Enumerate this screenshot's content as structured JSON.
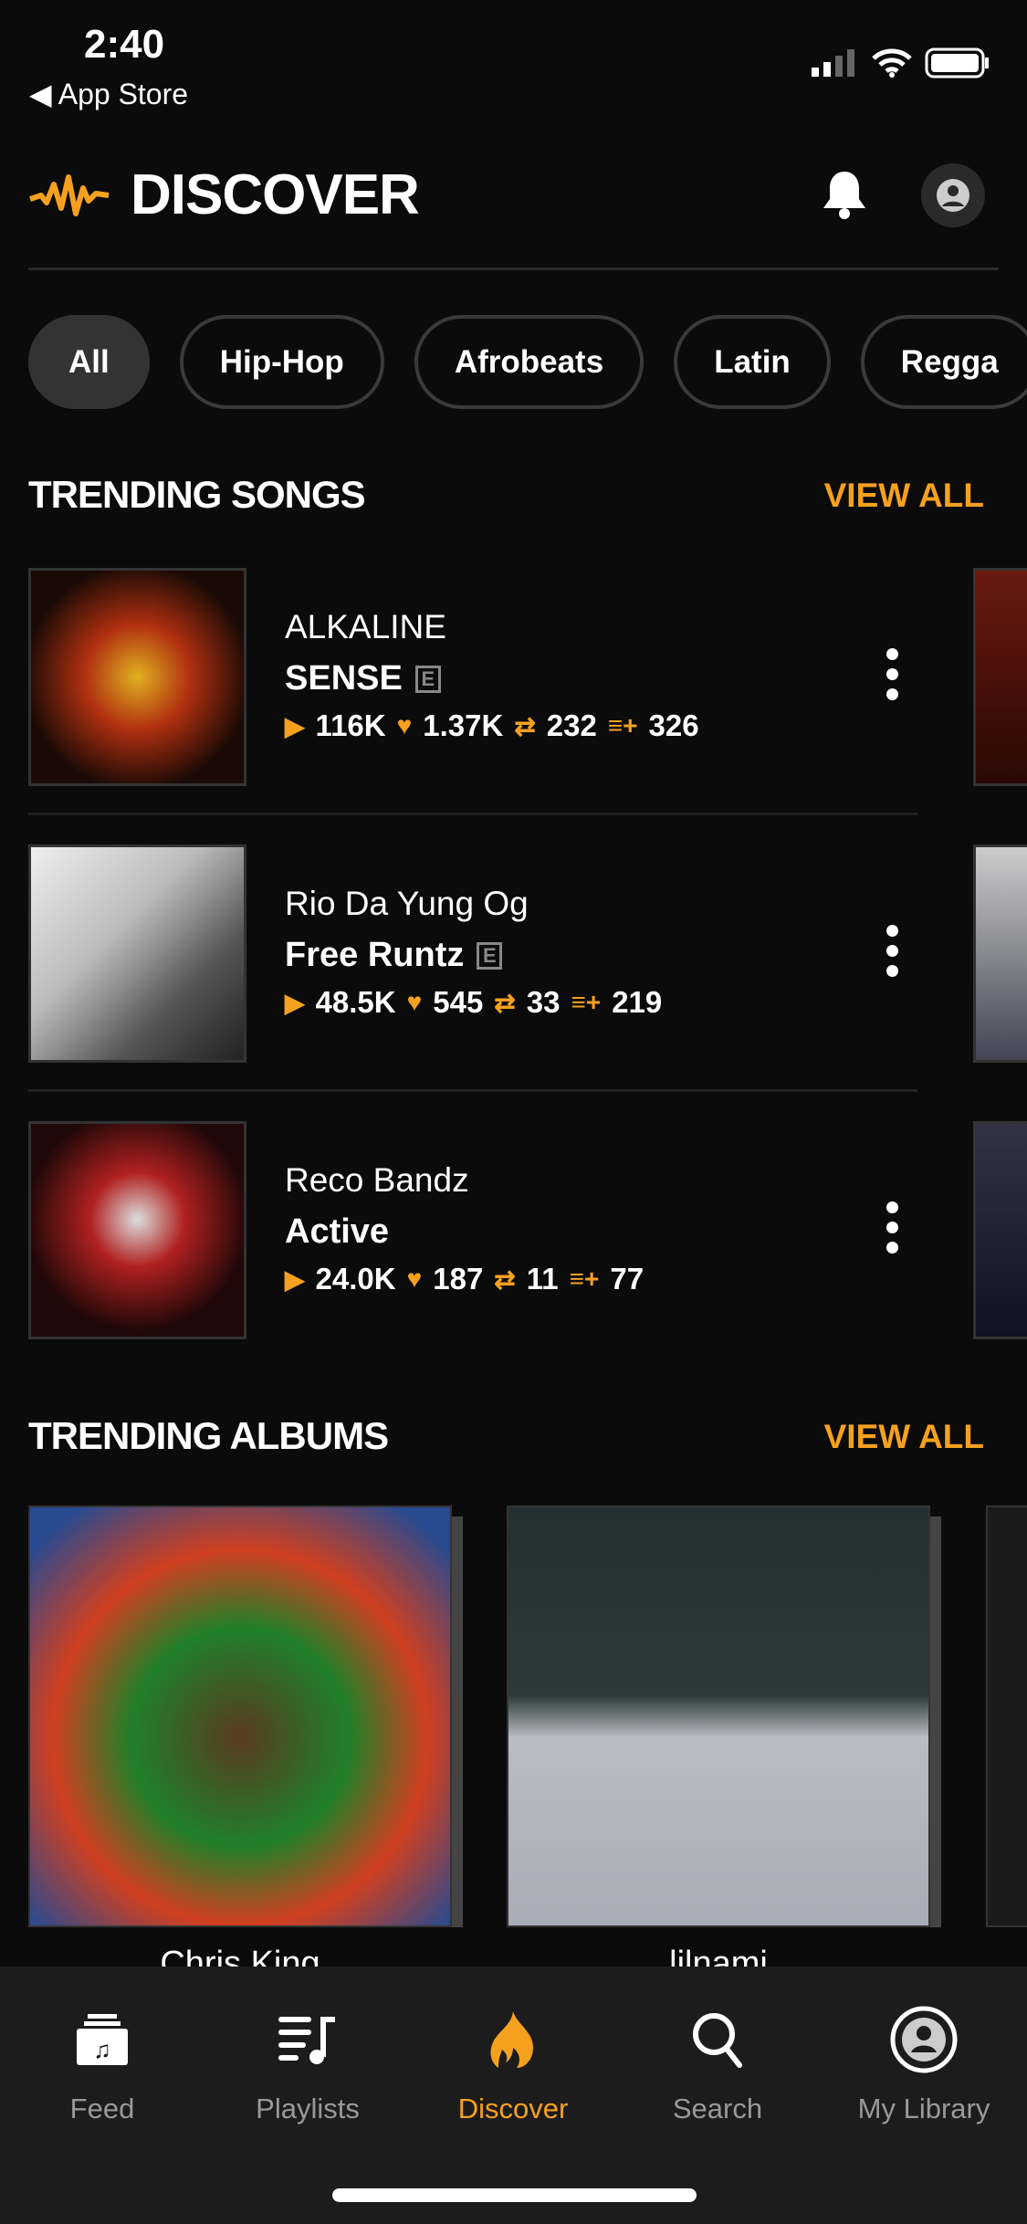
{
  "status": {
    "time": "2:40",
    "back_label": "App Store"
  },
  "header": {
    "title": "DISCOVER",
    "icons": [
      "audiomack-logo",
      "bell-icon",
      "profile-icon"
    ]
  },
  "genres": [
    {
      "label": "All",
      "active": true
    },
    {
      "label": "Hip-Hop"
    },
    {
      "label": "Afrobeats"
    },
    {
      "label": "Latin"
    },
    {
      "label": "Regga"
    }
  ],
  "trending_songs": {
    "title": "TRENDING SONGS",
    "view_all": "VIEW ALL",
    "items": [
      {
        "artist": "ALKALINE",
        "title": "SENSE",
        "explicit": "E",
        "plays": "116K",
        "favorites": "1.37K",
        "reposts": "232",
        "playlist_adds": "326"
      },
      {
        "artist": "Rio Da Yung Og",
        "title": "Free Runtz",
        "explicit": "E",
        "plays": "48.5K",
        "favorites": "545",
        "reposts": "33",
        "playlist_adds": "219"
      },
      {
        "artist": "Reco Bandz",
        "title": "Active",
        "explicit": "",
        "plays": "24.0K",
        "favorites": "187",
        "reposts": "11",
        "playlist_adds": "77"
      }
    ]
  },
  "trending_albums": {
    "title": "TRENDING ALBUMS",
    "view_all": "VIEW ALL",
    "items": [
      {
        "artist": "Chris King"
      },
      {
        "artist": "lilnami"
      }
    ]
  },
  "tabs": [
    {
      "label": "Feed",
      "icon": "feed-icon"
    },
    {
      "label": "Playlists",
      "icon": "playlists-icon"
    },
    {
      "label": "Discover",
      "icon": "flame-icon",
      "active": true
    },
    {
      "label": "Search",
      "icon": "search-icon"
    },
    {
      "label": "My Library",
      "icon": "library-icon"
    }
  ],
  "colors": {
    "accent": "#f5a11f",
    "background": "#0b0b0b",
    "tabbar": "#1c1c1c"
  }
}
